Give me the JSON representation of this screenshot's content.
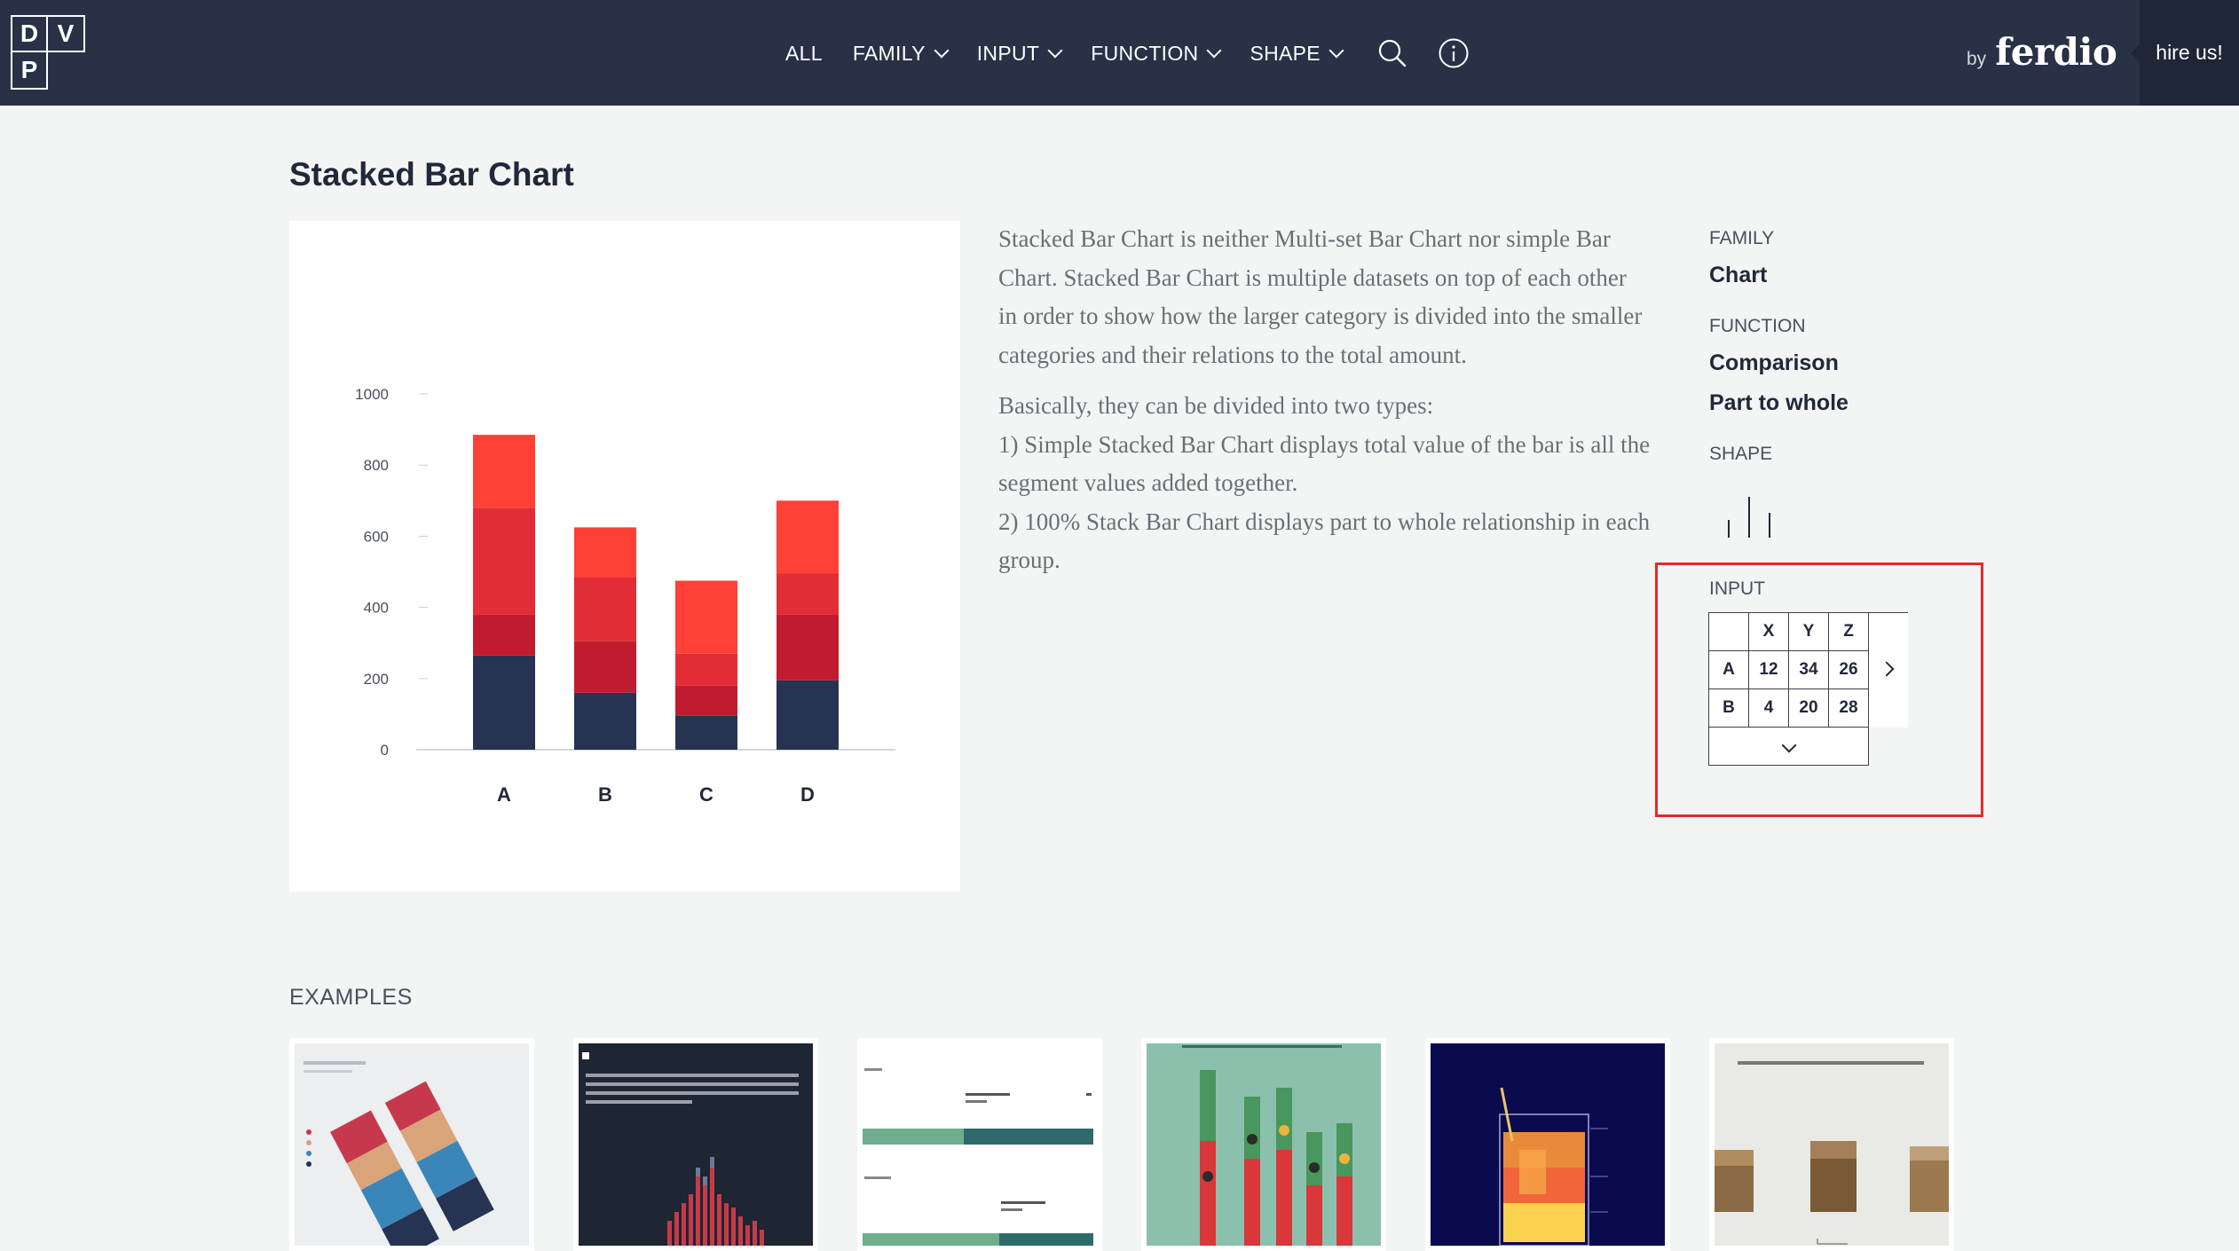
{
  "logo": {
    "letters": [
      "D",
      "V",
      "P",
      ""
    ]
  },
  "nav": {
    "items": [
      {
        "label": "ALL",
        "dropdown": false
      },
      {
        "label": "FAMILY",
        "dropdown": true
      },
      {
        "label": "INPUT",
        "dropdown": true
      },
      {
        "label": "FUNCTION",
        "dropdown": true
      },
      {
        "label": "SHAPE",
        "dropdown": true
      }
    ],
    "icons": [
      "search-icon",
      "info-icon"
    ]
  },
  "brand": {
    "by": "by",
    "name": "ferdio"
  },
  "hire": {
    "label": "hire us!"
  },
  "page": {
    "title": "Stacked Bar Chart"
  },
  "description": {
    "p1_lines": [
      "Stacked Bar Chart is neither Multi-set Bar Chart nor simple Bar",
      "Chart. Stacked Bar Chart is multiple datasets on top of each other",
      "in order to show how the larger category is divided into the smaller",
      "categories and their relations to the total amount."
    ],
    "p2_lines": [
      "Basically, they can be divided into two types:",
      "1) Simple Stacked Bar Chart displays total value of the bar is all the",
      "segment values added together.",
      "2) 100% Stack Bar Chart displays part to whole relationship in each",
      "group."
    ]
  },
  "meta": {
    "family_label": "FAMILY",
    "family_value": "Chart",
    "function_label": "FUNCTION",
    "function_values": [
      "Comparison",
      "Part to whole"
    ],
    "shape_label": "SHAPE",
    "input_label": "INPUT"
  },
  "input_table": {
    "headers": [
      "X",
      "Y",
      "Z"
    ],
    "rows": [
      {
        "label": "A",
        "values": [
          "12",
          "34",
          "26"
        ]
      },
      {
        "label": "B",
        "values": [
          "4",
          "20",
          "28"
        ]
      }
    ]
  },
  "chart_data": {
    "type": "bar",
    "stacked": true,
    "categories": [
      "A",
      "B",
      "C",
      "D"
    ],
    "yticks": [
      "0",
      "200",
      "400",
      "600",
      "800",
      "1000"
    ],
    "ylim": [
      0,
      1000
    ],
    "series": [
      {
        "values": [
          265,
          160,
          95,
          195
        ],
        "color": "#263353"
      },
      {
        "values": [
          115,
          145,
          85,
          185
        ],
        "color": "#c01b2e"
      },
      {
        "values": [
          300,
          180,
          90,
          115
        ],
        "color": "#e22d37"
      },
      {
        "values": [
          205,
          140,
          205,
          205
        ],
        "color": "#fe4036"
      }
    ],
    "title": "",
    "xlabel": "",
    "ylabel": ""
  },
  "examples": {
    "label": "EXAMPLES",
    "items": [
      "example-1",
      "example-2",
      "example-3",
      "example-4",
      "example-5",
      "example-6"
    ]
  }
}
